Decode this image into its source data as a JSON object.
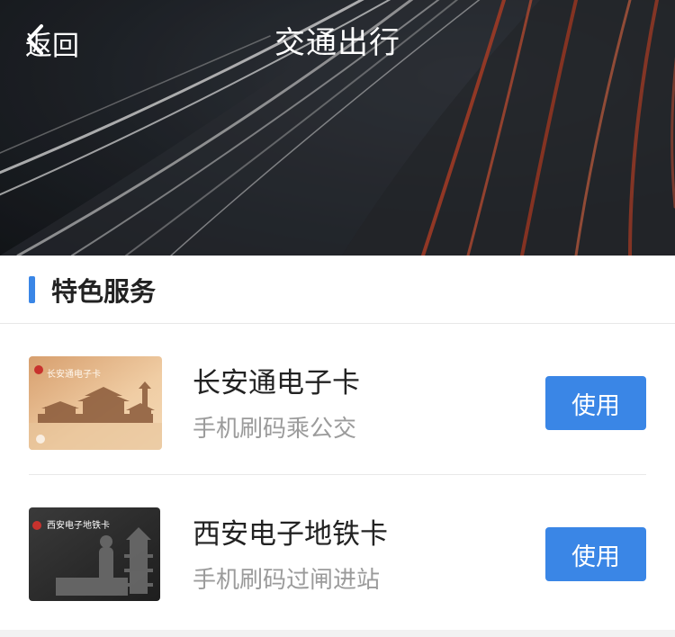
{
  "header": {
    "back_label": "返回",
    "title": "交通出行"
  },
  "section": {
    "title": "特色服务",
    "accent_color": "#3a86e6"
  },
  "services": [
    {
      "name": "长安通电子卡",
      "desc": "手机刷码乘公交",
      "button": "使用",
      "thumb_text": "长安通电子卡"
    },
    {
      "name": "西安电子地铁卡",
      "desc": "手机刷码过闸进站",
      "button": "使用",
      "thumb_text": "西安电子地铁卡"
    }
  ]
}
